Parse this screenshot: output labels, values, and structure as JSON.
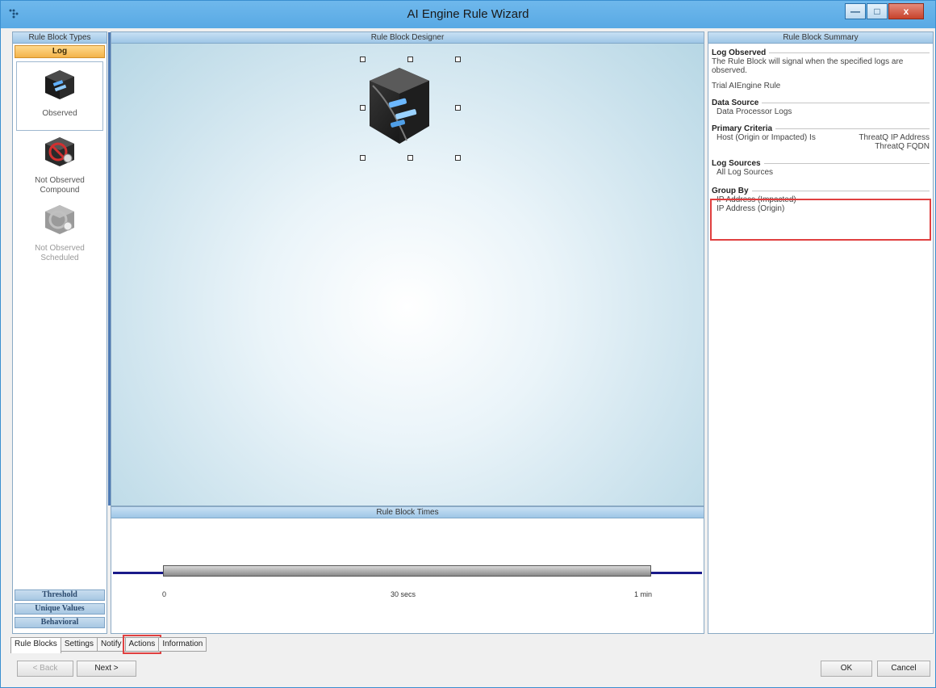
{
  "window": {
    "title": "AI Engine Rule Wizard",
    "minimize": "—",
    "maximize": "□",
    "close": "x"
  },
  "left": {
    "header": "Rule Block Types",
    "selected_category": "Log",
    "types": [
      {
        "label": "Observed"
      },
      {
        "label": "Not Observed Compound"
      },
      {
        "label": "Not Observed Scheduled"
      }
    ],
    "categories": [
      "Threshold",
      "Unique Values",
      "Behavioral"
    ]
  },
  "designer": {
    "header": "Rule Block Designer"
  },
  "times": {
    "header": "Rule Block Times",
    "labels": [
      "0",
      "30 secs",
      "1 min"
    ]
  },
  "summary": {
    "header": "Rule Block Summary",
    "log_observed_title": "Log Observed",
    "log_observed_text": "The Rule Block will signal when the specified logs are observed.",
    "rule_name": "Trial AIEngine Rule",
    "data_source_title": "Data Source",
    "data_source_value": "Data Processor Logs",
    "primary_criteria_title": "Primary Criteria",
    "criteria_left": "Host (Origin or Impacted) Is",
    "criteria_right_1": "ThreatQ IP Address",
    "criteria_right_2": "ThreatQ FQDN",
    "log_sources_title": "Log Sources",
    "log_sources_value": "All Log Sources",
    "group_by_title": "Group By",
    "group_by_items": [
      "IP Address (Impacted)",
      "IP Address (Origin)"
    ]
  },
  "tabs": [
    "Rule Blocks",
    "Settings",
    "Notify",
    "Actions",
    "Information"
  ],
  "buttons": {
    "back": "< Back",
    "next": "Next >",
    "ok": "OK",
    "cancel": "Cancel"
  }
}
